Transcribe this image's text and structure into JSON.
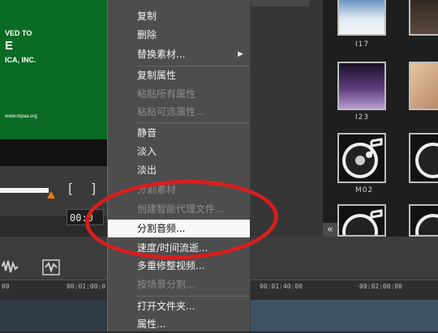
{
  "preview": {
    "rating_lines": [
      "VED TO",
      "E",
      "ICA, INC.",
      "www.mpaa.org"
    ],
    "timecode": "00:0"
  },
  "scrub": {
    "left_bracket": "[",
    "right_bracket": "]",
    "progress": 0.45
  },
  "library": {
    "thumbs": [
      {
        "label": "I17",
        "type": "winter-forest-image"
      },
      {
        "label": "",
        "type": "dark-image"
      },
      {
        "label": "I23",
        "type": "purple-room-image"
      },
      {
        "label": "",
        "type": "skin-tone-image"
      },
      {
        "label": "M02",
        "type": "music-file-icon"
      },
      {
        "label": "",
        "type": "music-file-icon"
      },
      {
        "label": "",
        "type": "music-file-icon"
      },
      {
        "label": "",
        "type": "music-file-icon"
      }
    ],
    "collapse_label": "«"
  },
  "timeline": {
    "ruler_labels": [
      "00",
      "00:01:00:0",
      "00:01:40:00",
      "00:02:00:00"
    ]
  },
  "context_menu": {
    "items": [
      {
        "label": "复制",
        "enabled": true
      },
      {
        "label": "删除",
        "enabled": true
      },
      {
        "label": "替换素材...",
        "enabled": true,
        "submenu": true,
        "arrow": "▶"
      },
      {
        "label": "复制属性",
        "enabled": true
      },
      {
        "label": "粘贴所有属性",
        "enabled": false
      },
      {
        "label": "粘贴可选属性...",
        "enabled": false
      },
      {
        "label": "静音",
        "enabled": true
      },
      {
        "label": "淡入",
        "enabled": true
      },
      {
        "label": "淡出",
        "enabled": true
      },
      {
        "label": "分割素材",
        "enabled": false
      },
      {
        "label": "创建智能代理文件...",
        "enabled": false
      },
      {
        "label": "分割音频...",
        "enabled": true,
        "highlighted": true
      },
      {
        "label": "速度/时间流逝...",
        "enabled": true
      },
      {
        "label": "多重修整视频...",
        "enabled": true
      },
      {
        "label": "按场景分割...",
        "enabled": false
      },
      {
        "label": "打开文件夹...",
        "enabled": true
      },
      {
        "label": "属性...",
        "enabled": true
      }
    ]
  },
  "colors": {
    "highlight_ellipse": "#d61e1e",
    "scrub_handle": "#f07a10",
    "preview_green": "#0b6a24"
  }
}
